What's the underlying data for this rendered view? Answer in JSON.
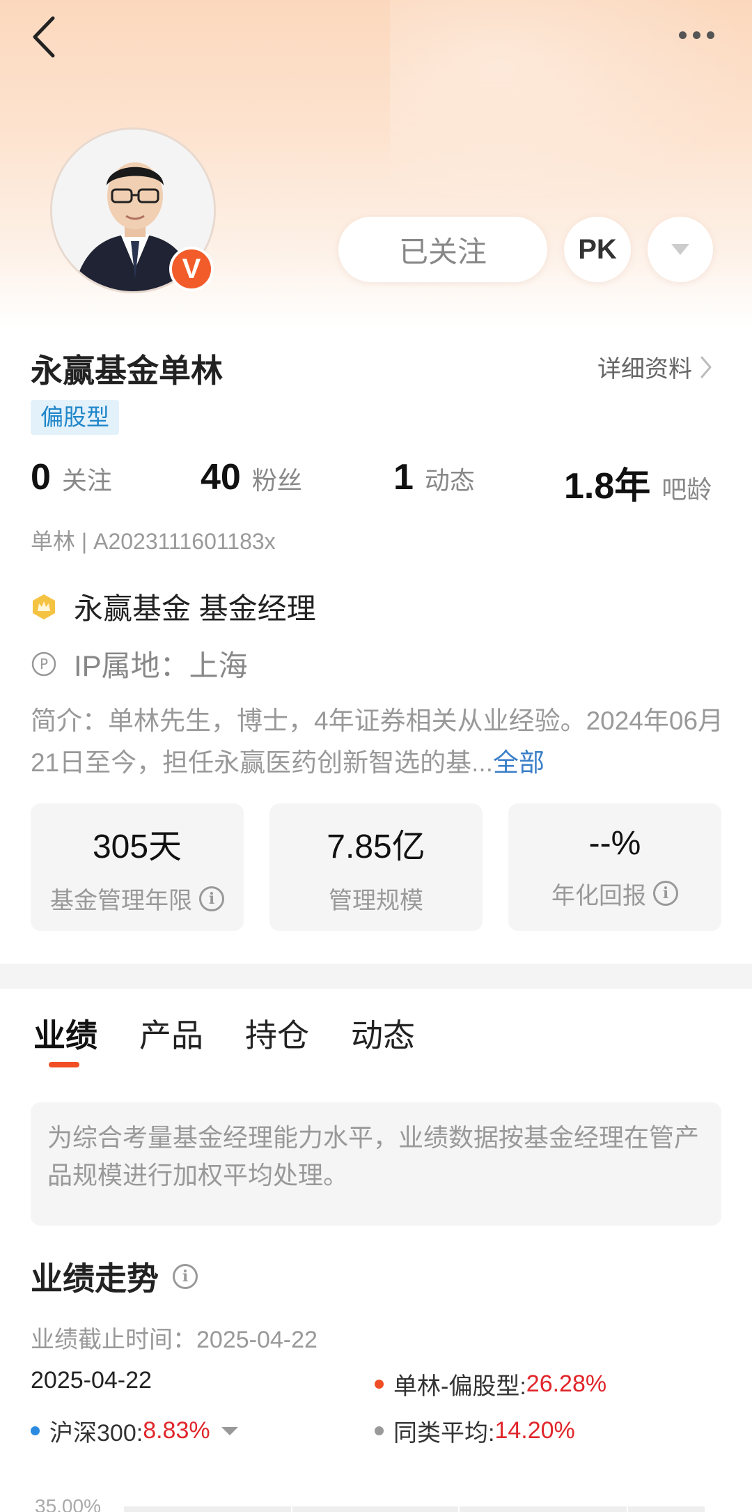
{
  "header": {
    "back_icon": "chevron-left-icon",
    "more_icon": "more-dots-icon"
  },
  "profile": {
    "verified_badge": "V",
    "follow_label": "已关注",
    "pk_label": "PK",
    "name": "永赢基金单林",
    "detail_label": "详细资料",
    "type_tag": "偏股型",
    "stats": [
      {
        "num": "0",
        "label": "关注"
      },
      {
        "num": "40",
        "label": "粉丝"
      },
      {
        "num": "1",
        "label": "动态"
      },
      {
        "num": "1.8年",
        "label": "吧龄"
      }
    ],
    "uid": "单林 | A2023111601183x",
    "org": "永赢基金 基金经理",
    "ip": "IP属地：上海",
    "intro": "简介：单林先生，博士，4年证券相关从业经验。2024年06月21日至今，担任永赢医药创新智选的基...",
    "intro_more": "全部"
  },
  "cards": [
    {
      "value": "305天",
      "caption": "基金管理年限",
      "info": true
    },
    {
      "value": "7.85亿",
      "caption": "管理规模",
      "info": false
    },
    {
      "value": "--%",
      "caption": "年化回报",
      "info": true
    }
  ],
  "tabs": [
    "业绩",
    "产品",
    "持仓",
    "动态"
  ],
  "active_tab": "业绩",
  "note": "为综合考量基金经理能力水平，业绩数据按基金经理在管产品规模进行加权平均处理。",
  "performance": {
    "title": "业绩走势",
    "cutoff": "业绩截止时间：2025-04-22",
    "date": "2025-04-22",
    "series": [
      {
        "name": "单林-偏股型:",
        "value": "26.28%",
        "color": "#f04e24"
      },
      {
        "name": "沪深300:",
        "value": "8.83%",
        "color": "#2b8be0"
      },
      {
        "name": "同类平均:",
        "value": "14.20%",
        "color": "#999999"
      }
    ],
    "y_top_label": "35.00%"
  },
  "colors": {
    "accent": "#f04e24",
    "tag_bg": "#e3f1fb",
    "tag_text": "#1f86c9",
    "positive": "#e0262b",
    "link": "#3b7fc8"
  }
}
